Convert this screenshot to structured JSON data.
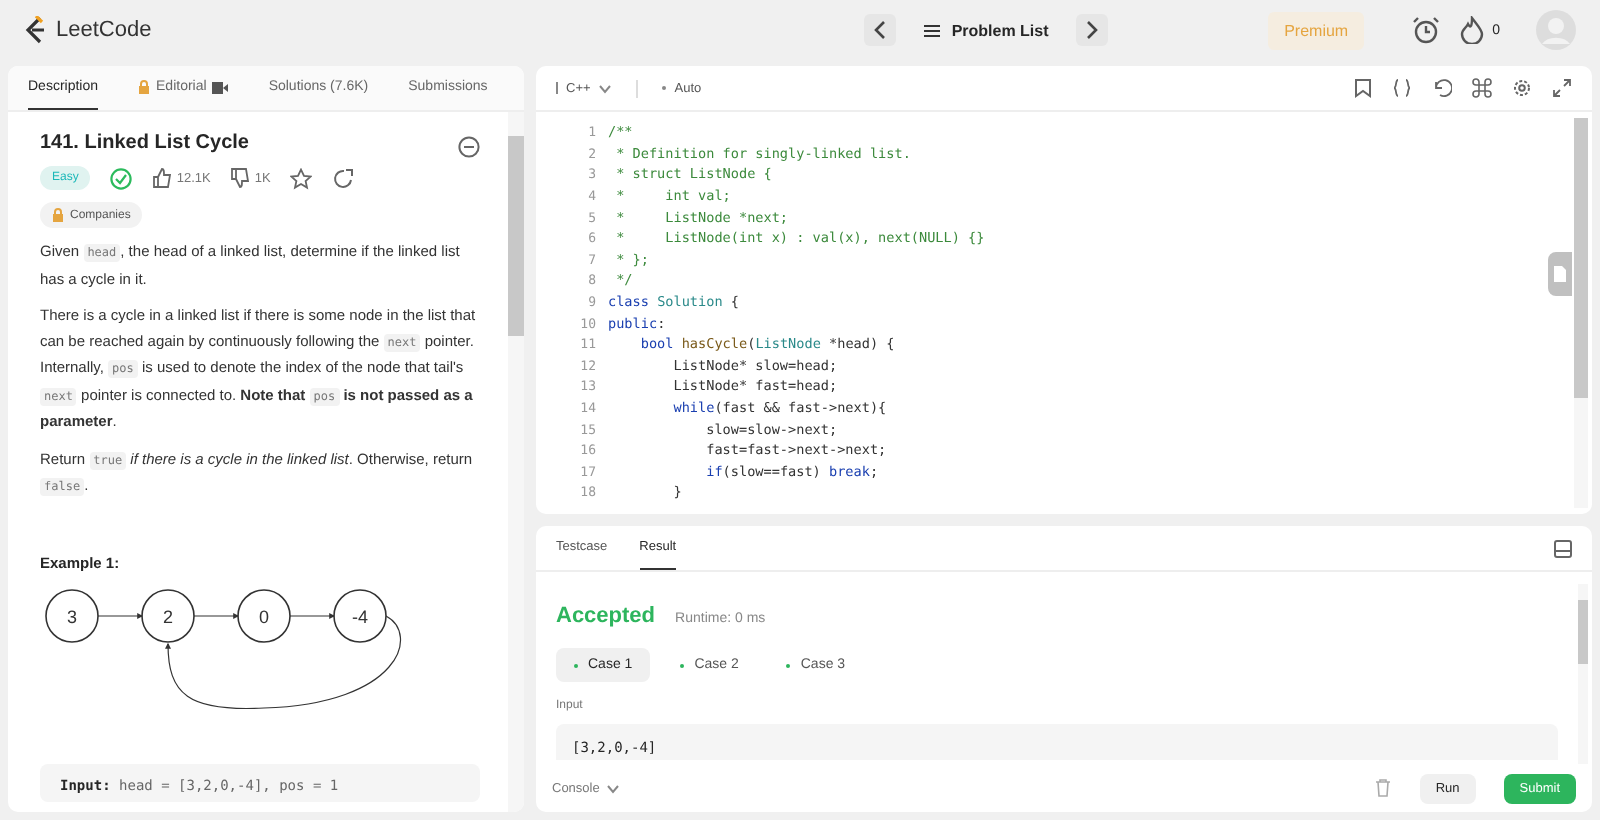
{
  "topbar": {
    "logo": "LeetCode",
    "nav_title": "Problem List",
    "premium": "Premium",
    "streak": "0"
  },
  "left_tabs": [
    {
      "label": "Description",
      "kind": "plain",
      "selected": true
    },
    {
      "label": "Editorial",
      "kind": "locked",
      "selected": false
    },
    {
      "label": "Solutions (7.6K)",
      "kind": "plain",
      "selected": false
    },
    {
      "label": "Submissions",
      "kind": "plain",
      "selected": false
    }
  ],
  "problem": {
    "title": "141. Linked List Cycle",
    "difficulty": "Easy",
    "solved": true,
    "likes": "12.1K",
    "dislikes": "1K",
    "companies": "Companies",
    "paragraphs": [
      [
        {
          "kind": "text",
          "text": "Given "
        },
        {
          "kind": "code",
          "text": "head"
        },
        {
          "kind": "text",
          "text": ", the head of a linked list, determine if the linked list has a cycle in it."
        }
      ],
      [
        {
          "kind": "text",
          "text": "There is a cycle in a linked list if there is some node in the list that can be reached again by continuously following the "
        },
        {
          "kind": "code",
          "text": "next"
        },
        {
          "kind": "text",
          "text": " pointer. Internally, "
        },
        {
          "kind": "code",
          "text": "pos"
        },
        {
          "kind": "text",
          "text": " is used to denote the index of the node that tail's "
        },
        {
          "kind": "code",
          "text": "next"
        },
        {
          "kind": "text",
          "text": " pointer is connected to. "
        },
        {
          "kind": "bold",
          "text": "Note that "
        },
        {
          "kind": "code",
          "text": "pos"
        },
        {
          "kind": "bold",
          "text": " is not passed as a parameter"
        },
        {
          "kind": "text",
          "text": "."
        }
      ],
      [
        {
          "kind": "text",
          "text": "Return "
        },
        {
          "kind": "code",
          "text": "true"
        },
        {
          "kind": "italic",
          "text": " if there is a cycle in the linked list"
        },
        {
          "kind": "text",
          "text": ". Otherwise, return "
        },
        {
          "kind": "code",
          "text": "false"
        },
        {
          "kind": "text",
          "text": "."
        }
      ]
    ],
    "example_title": "Example 1:",
    "nodes": [
      "3",
      "2",
      "0",
      "-4"
    ],
    "example_input": [
      {
        "kind": "bold",
        "text": "Input:"
      },
      {
        "kind": "text",
        "text": " head = [3,2,0,-4], pos = 1"
      }
    ]
  },
  "editor": {
    "language": "C++",
    "mode": "Auto",
    "lines": [
      {
        "num": "1",
        "tokens": [
          {
            "kind": "comment",
            "text": "/**"
          }
        ]
      },
      {
        "num": "2",
        "tokens": [
          {
            "kind": "comment",
            "text": " * Definition for singly-linked list."
          }
        ]
      },
      {
        "num": "3",
        "tokens": [
          {
            "kind": "comment",
            "text": " * struct ListNode {"
          }
        ]
      },
      {
        "num": "4",
        "tokens": [
          {
            "kind": "comment",
            "text": " *     int val;"
          }
        ]
      },
      {
        "num": "5",
        "tokens": [
          {
            "kind": "comment",
            "text": " *     ListNode *next;"
          }
        ]
      },
      {
        "num": "6",
        "tokens": [
          {
            "kind": "comment",
            "text": " *     ListNode(int x) : val(x), next(NULL) {}"
          }
        ]
      },
      {
        "num": "7",
        "tokens": [
          {
            "kind": "comment",
            "text": " * };"
          }
        ]
      },
      {
        "num": "8",
        "tokens": [
          {
            "kind": "comment",
            "text": " */"
          }
        ]
      },
      {
        "num": "9",
        "tokens": [
          {
            "kind": "keyword",
            "text": "class "
          },
          {
            "kind": "type",
            "text": "Solution"
          },
          {
            "kind": "plain",
            "text": " {"
          }
        ]
      },
      {
        "num": "10",
        "tokens": [
          {
            "kind": "keyword",
            "text": "public"
          },
          {
            "kind": "plain",
            "text": ":"
          }
        ]
      },
      {
        "num": "11",
        "tokens": [
          {
            "kind": "keyword",
            "text": "    bool "
          },
          {
            "kind": "func",
            "text": "hasCycle"
          },
          {
            "kind": "plain",
            "text": "("
          },
          {
            "kind": "type",
            "text": "ListNode"
          },
          {
            "kind": "plain",
            "text": " *head) {"
          }
        ]
      },
      {
        "num": "12",
        "tokens": [
          {
            "kind": "plain",
            "text": "        ListNode* slow=head;"
          }
        ]
      },
      {
        "num": "13",
        "tokens": [
          {
            "kind": "plain",
            "text": "        ListNode* fast=head;"
          }
        ]
      },
      {
        "num": "14",
        "tokens": [
          {
            "kind": "keyword",
            "text": "        while"
          },
          {
            "kind": "plain",
            "text": "(fast && fast->next){"
          }
        ]
      },
      {
        "num": "15",
        "tokens": [
          {
            "kind": "plain",
            "text": "            slow=slow->next;"
          }
        ]
      },
      {
        "num": "16",
        "tokens": [
          {
            "kind": "plain",
            "text": "            fast=fast->next->next;"
          }
        ]
      },
      {
        "num": "17",
        "tokens": [
          {
            "kind": "keyword",
            "text": "            if"
          },
          {
            "kind": "plain",
            "text": "(slow==fast) "
          },
          {
            "kind": "keyword",
            "text": "break"
          },
          {
            "kind": "plain",
            "text": ";"
          }
        ]
      },
      {
        "num": "18",
        "tokens": [
          {
            "kind": "plain",
            "text": "        }"
          }
        ]
      }
    ]
  },
  "result_tabs": [
    {
      "label": "Testcase",
      "selected": false
    },
    {
      "label": "Result",
      "selected": true
    }
  ],
  "result": {
    "status": "Accepted",
    "runtime": "Runtime: 0 ms",
    "cases": [
      {
        "label": "Case 1",
        "selected": true
      },
      {
        "label": "Case 2",
        "selected": false
      },
      {
        "label": "Case 3",
        "selected": false
      }
    ],
    "input_label": "Input",
    "input_value": "[3,2,0,-4]"
  },
  "footer": {
    "console": "Console",
    "run": "Run",
    "submit": "Submit"
  }
}
